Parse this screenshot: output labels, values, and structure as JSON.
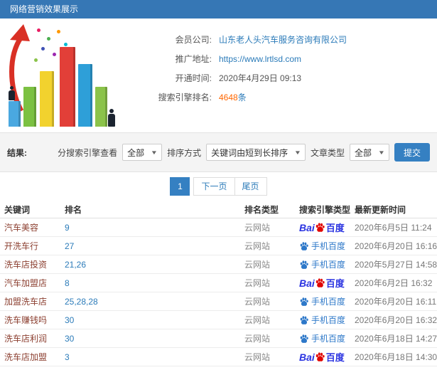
{
  "header": {
    "title": "网络营销效果展示"
  },
  "icons": {
    "caret": "▼"
  },
  "logos": {
    "baidu_prefix": "Bai"
  },
  "info": {
    "company": {
      "label": "会员公司:",
      "value": "山东老人头汽车服务咨询有限公司"
    },
    "site": {
      "label": "推广地址:",
      "value": "https://www.lrtlsd.com"
    },
    "open_time": {
      "label": "开通时间:",
      "value": "2020年4月29日 09:13"
    },
    "rank_count": {
      "label": "搜索引擎排名:",
      "value": "4648",
      "suffix": "条"
    }
  },
  "filters": {
    "result_label": "结果:",
    "engine_label": "分搜索引擎查看",
    "engine_value": "全部",
    "sort_label": "排序方式",
    "sort_value": "关键词由短到长排序",
    "type_label": "文章类型",
    "type_value": "全部",
    "submit_label": "提交"
  },
  "pagination": {
    "current": "1",
    "next": "下一页",
    "last": "尾页"
  },
  "table": {
    "headers": [
      "关键词",
      "排名",
      "排名类型",
      "搜索引擎类型",
      "最新更新时间"
    ],
    "rows": [
      {
        "keyword": "汽车美容",
        "rank": "9",
        "rank_type": "云网站",
        "engine": "baidu-pc",
        "engine_label": "百度",
        "time": "2020年6月5日 11:24"
      },
      {
        "keyword": "开洗车行",
        "rank": "27",
        "rank_type": "云网站",
        "engine": "baidu-mobile",
        "engine_label": "手机百度",
        "time": "2020年6月20日 16:16"
      },
      {
        "keyword": "洗车店投资",
        "rank": "21,26",
        "rank_type": "云网站",
        "engine": "baidu-mobile",
        "engine_label": "手机百度",
        "time": "2020年5月27日 14:58"
      },
      {
        "keyword": "汽车加盟店",
        "rank": "8",
        "rank_type": "云网站",
        "engine": "baidu-pc",
        "engine_label": "百度",
        "time": "2020年6月2日 16:32"
      },
      {
        "keyword": "加盟洗车店",
        "rank": "25,28,28",
        "rank_type": "云网站",
        "engine": "baidu-mobile",
        "engine_label": "手机百度",
        "time": "2020年6月20日 16:11"
      },
      {
        "keyword": "洗车赚钱吗",
        "rank": "30",
        "rank_type": "云网站",
        "engine": "baidu-mobile",
        "engine_label": "手机百度",
        "time": "2020年6月20日 16:32"
      },
      {
        "keyword": "洗车店利润",
        "rank": "30",
        "rank_type": "云网站",
        "engine": "baidu-mobile",
        "engine_label": "手机百度",
        "time": "2020年6月18日 14:27"
      },
      {
        "keyword": "洗车店加盟",
        "rank": "3",
        "rank_type": "云网站",
        "engine": "baidu-pc",
        "engine_label": "百度",
        "time": "2020年6月18日 14:30"
      }
    ]
  }
}
